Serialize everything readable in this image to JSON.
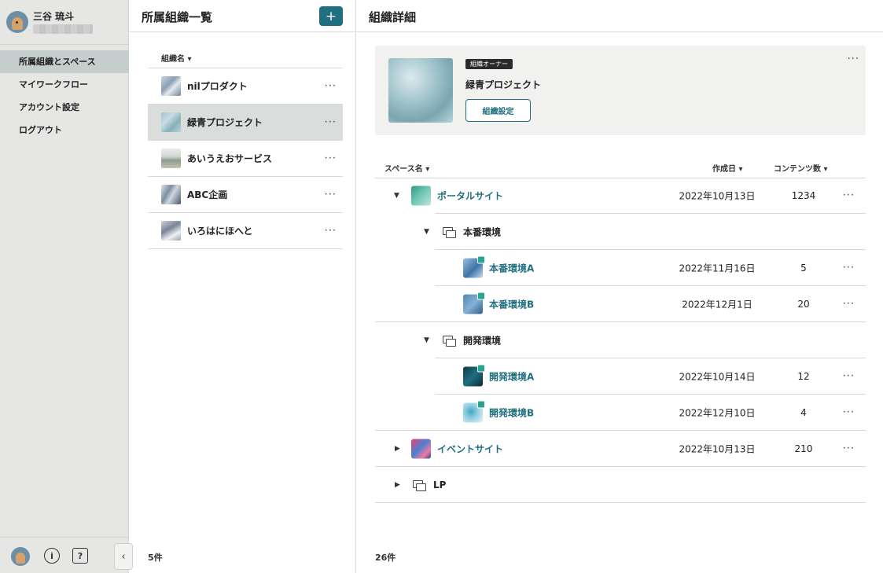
{
  "user": {
    "name": "三谷 琉斗"
  },
  "sidebar": {
    "items": [
      {
        "label": "所属組織とスペース",
        "active": true
      },
      {
        "label": "マイワークフロー",
        "active": false
      },
      {
        "label": "アカウント設定",
        "active": false
      },
      {
        "label": "ログアウト",
        "active": false
      }
    ],
    "collapse_glyph": "‹",
    "info_glyph": "i",
    "help_glyph": "?"
  },
  "org_list": {
    "title": "所属組織一覧",
    "add_label": "+",
    "sort_label": "組織名 ▾",
    "count_label": "5件",
    "orgs": [
      {
        "name": "nilプロダクト",
        "thumb": "t-nil",
        "selected": false
      },
      {
        "name": "緑青プロジェクト",
        "thumb": "t-green",
        "selected": true
      },
      {
        "name": "あいうえおサービス",
        "thumb": "t-aiu",
        "selected": false
      },
      {
        "name": "ABC企画",
        "thumb": "t-abc",
        "selected": false
      },
      {
        "name": "いろはにほへと",
        "thumb": "t-iro",
        "selected": false
      }
    ]
  },
  "detail": {
    "title": "組織詳細",
    "owner_badge": "組織オーナー",
    "org_name": "緑青プロジェクト",
    "settings_button": "組織設定",
    "headers": {
      "space": "スペース名 ▾",
      "created": "作成日 ▾",
      "contents": "コンテンツ数 ▾"
    },
    "count_label": "26件",
    "spaces": [
      {
        "kind": "site",
        "level": 0,
        "caret": "▼",
        "name": "ポータルサイト",
        "date": "2022年10月13日",
        "count": "1234",
        "icon": "i-portal"
      },
      {
        "kind": "group",
        "level": 1,
        "caret": "▼",
        "name": "本番環境",
        "date": "",
        "count": ""
      },
      {
        "kind": "site",
        "level": 2,
        "caret": "",
        "name": "本番環境A",
        "date": "2022年11月16日",
        "count": "5",
        "icon": "i-hA"
      },
      {
        "kind": "site",
        "level": 2,
        "caret": "",
        "name": "本番環境B",
        "date": "2022年12月1日",
        "count": "20",
        "icon": "i-hB"
      },
      {
        "kind": "group",
        "level": 1,
        "caret": "▼",
        "name": "開発環境",
        "date": "",
        "count": ""
      },
      {
        "kind": "site",
        "level": 2,
        "caret": "",
        "name": "開発環境A",
        "date": "2022年10月14日",
        "count": "12",
        "icon": "i-dA"
      },
      {
        "kind": "site",
        "level": 2,
        "caret": "",
        "name": "開発環境B",
        "date": "2022年12月10日",
        "count": "4",
        "icon": "i-dB"
      },
      {
        "kind": "site",
        "level": 0,
        "caret": "▶",
        "name": "イベントサイト",
        "date": "2022年10月13日",
        "count": "210",
        "icon": "i-event"
      },
      {
        "kind": "group",
        "level": 0,
        "caret": "▶",
        "name": "LP",
        "date": "",
        "count": ""
      }
    ]
  },
  "ui": {
    "more_glyph": "···"
  },
  "colors": {
    "accent": "#1f6f80",
    "sidebar_bg": "#e6e6e4",
    "selected_bg": "#d9dedd",
    "card_bg": "#f1f1f0"
  }
}
